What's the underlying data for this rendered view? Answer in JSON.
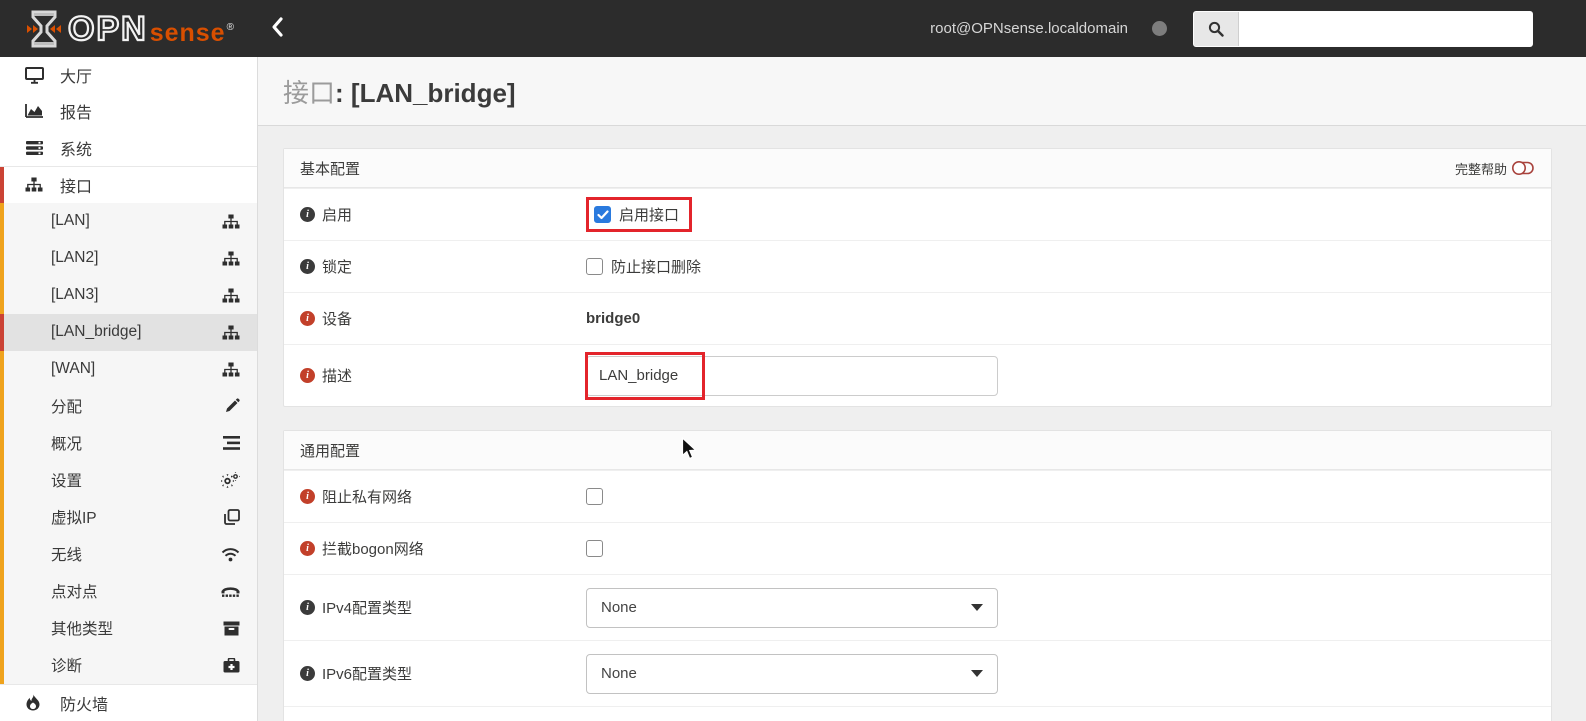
{
  "header": {
    "brand_opn": "OPN",
    "brand_sense": "sense",
    "brand_reg": "®",
    "collapse_glyph": "‹",
    "user": "root@OPNsense.localdomain",
    "search_value": "",
    "search_placeholder": ""
  },
  "sidebar": {
    "top_items": [
      {
        "label": "大厅",
        "icon": "desktop-icon"
      },
      {
        "label": "报告",
        "icon": "area-chart-icon"
      },
      {
        "label": "系统",
        "icon": "server-icon"
      },
      {
        "label": "接口",
        "icon": "sitemap-icon",
        "active": true
      }
    ],
    "interface_children": [
      {
        "label": "[LAN]",
        "icon": "sitemap-icon"
      },
      {
        "label": "[LAN2]",
        "icon": "sitemap-icon"
      },
      {
        "label": "[LAN3]",
        "icon": "sitemap-icon"
      },
      {
        "label": "[LAN_bridge]",
        "icon": "sitemap-icon",
        "selected": true
      },
      {
        "label": "[WAN]",
        "icon": "sitemap-icon"
      },
      {
        "label": "分配",
        "icon": "pencil-icon"
      },
      {
        "label": "概况",
        "icon": "overview-icon"
      },
      {
        "label": "设置",
        "icon": "gears-icon"
      },
      {
        "label": "虚拟IP",
        "icon": "clone-icon"
      },
      {
        "label": "无线",
        "icon": "wifi-icon"
      },
      {
        "label": "点对点",
        "icon": "ppp-icon"
      },
      {
        "label": "其他类型",
        "icon": "archive-icon"
      },
      {
        "label": "诊断",
        "icon": "medkit-icon"
      }
    ],
    "bottom_items": [
      {
        "label": "防火墙",
        "icon": "fire-icon"
      }
    ]
  },
  "page": {
    "title_light": "接口",
    "title_sep": ": ",
    "title_main": "[LAN_bridge]"
  },
  "basic_panel": {
    "title": "基本配置",
    "help_label": "完整帮助",
    "rows": {
      "enable": {
        "label": "启用",
        "checkbox_text": "启用接口",
        "checked": true
      },
      "lock": {
        "label": "锁定",
        "checkbox_text": "防止接口删除",
        "checked": false
      },
      "device": {
        "label": "设备",
        "value": "bridge0"
      },
      "description": {
        "label": "描述",
        "value": "LAN_bridge"
      }
    }
  },
  "generic_panel": {
    "title": "通用配置",
    "rows": {
      "block_private": {
        "label": "阻止私有网络",
        "checked": false
      },
      "block_bogon": {
        "label": "拦截bogon网络",
        "checked": false
      },
      "ipv4_type": {
        "label": "IPv4配置类型",
        "value": "None"
      },
      "ipv6_type": {
        "label": "IPv6配置类型",
        "value": "None"
      }
    }
  },
  "colors": {
    "accent_orange": "#d94f00",
    "subnav_orange": "#efa31d",
    "active_red": "#cb4335",
    "annotation_red": "#e3242b",
    "checkbox_blue": "#2a7ade",
    "header_bg": "#2c2c2c"
  }
}
